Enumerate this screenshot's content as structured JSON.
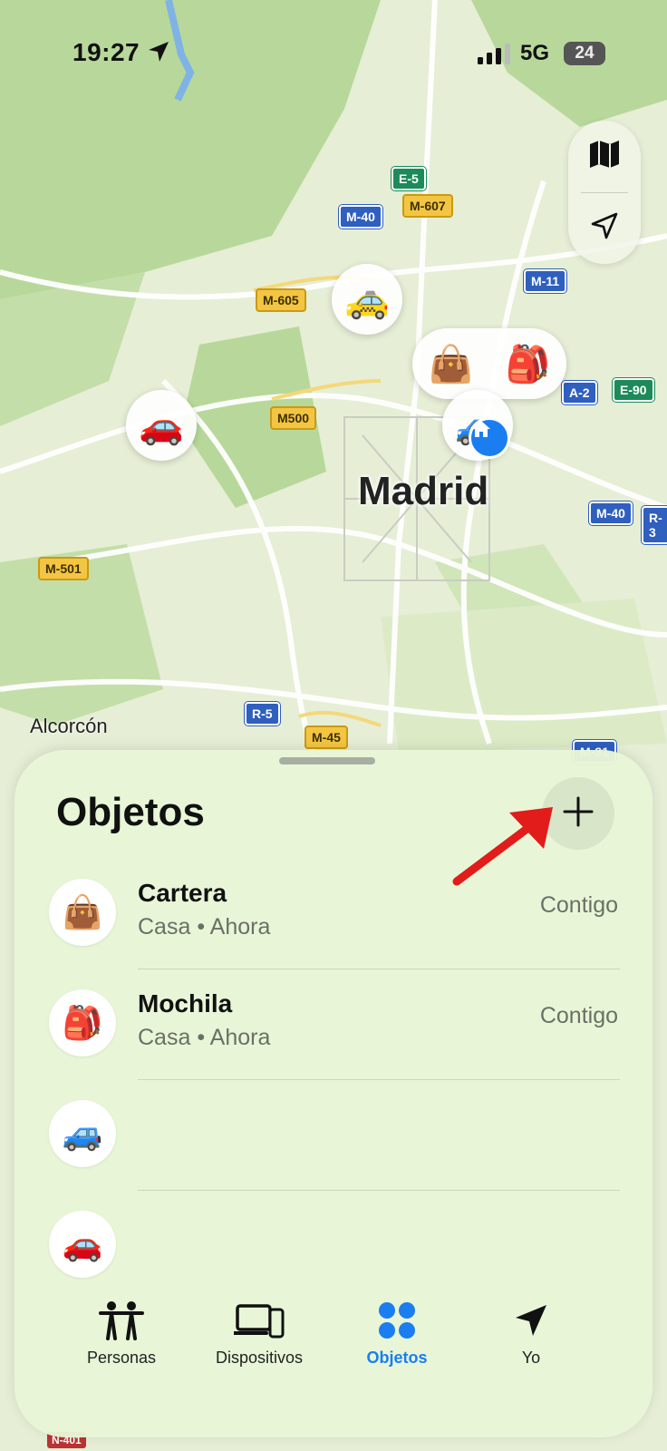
{
  "status_bar": {
    "time": "19:27",
    "network": "5G",
    "battery": "24"
  },
  "map": {
    "city_label": "Madrid",
    "town_label": "Alcorcón",
    "roads": [
      "E-5",
      "M-607",
      "M-40",
      "M-605",
      "M-11",
      "A-2",
      "E-90",
      "M500",
      "M-40",
      "R-3",
      "M-501",
      "R-5",
      "M-45",
      "M-31",
      "N-401"
    ]
  },
  "sheet": {
    "title": "Objetos",
    "items": [
      {
        "icon": "👜",
        "name": "Cartera",
        "location": "Casa",
        "time": "Ahora",
        "status": "Contigo"
      },
      {
        "icon": "🎒",
        "name": "Mochila",
        "location": "Casa",
        "time": "Ahora",
        "status": "Contigo"
      },
      {
        "icon": "🚙",
        "name": "",
        "location": "",
        "time": "",
        "status": ""
      },
      {
        "icon": "🚗",
        "name": "",
        "location": "",
        "time": "",
        "status": ""
      }
    ]
  },
  "tabs": [
    {
      "label": "Personas",
      "icon": "people-icon",
      "active": false
    },
    {
      "label": "Dispositivos",
      "icon": "devices-icon",
      "active": false
    },
    {
      "label": "Objetos",
      "icon": "items-icon",
      "active": true
    },
    {
      "label": "Yo",
      "icon": "location-arrow-icon",
      "active": false
    }
  ],
  "colors": {
    "accent": "#1a7ef0",
    "annotation_arrow": "#e21b1b",
    "map_green": "#b9d99a"
  }
}
